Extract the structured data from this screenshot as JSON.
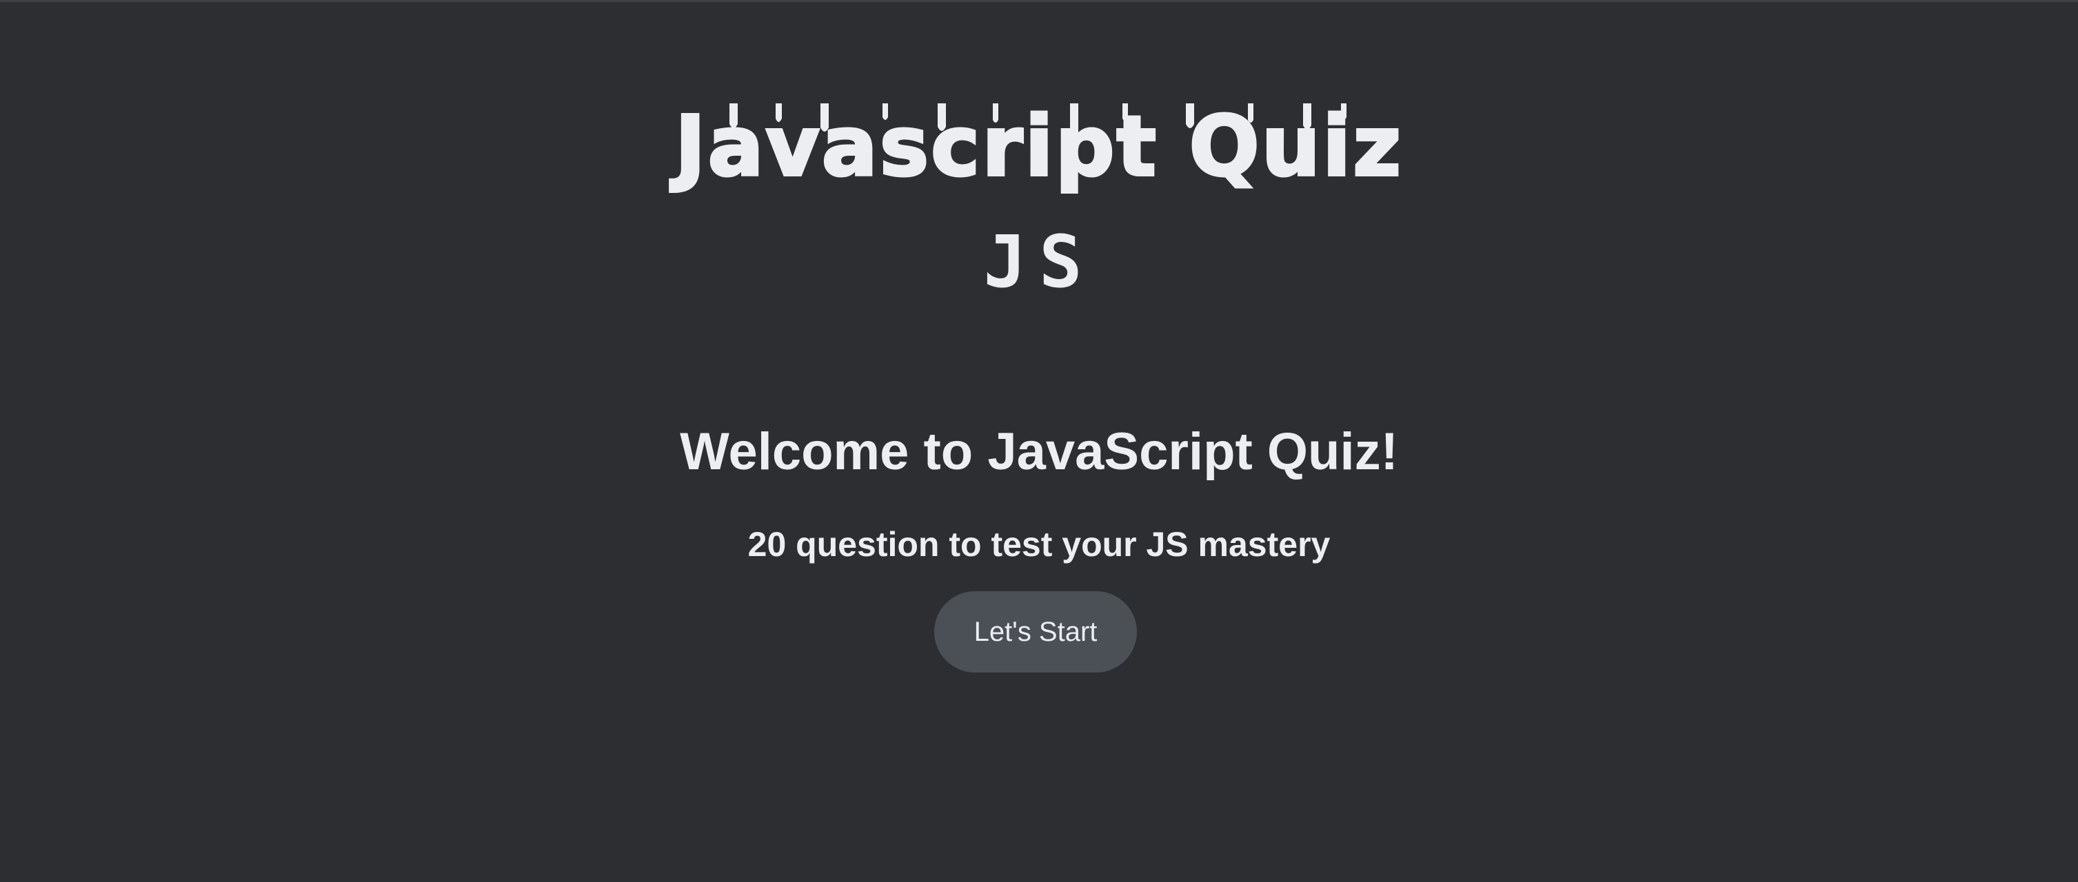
{
  "header": {
    "title": "Javascript Quiz",
    "logo_text": "JS"
  },
  "intro": {
    "welcome": "Welcome to JavaScript Quiz!",
    "subtitle": "20 question to test your JS mastery",
    "start_label": "Let's Start"
  },
  "colors": {
    "background": "#2d2e32",
    "text": "#eceef2",
    "button_background": "#4b4f56"
  }
}
